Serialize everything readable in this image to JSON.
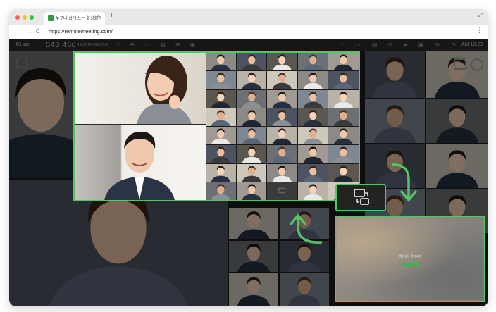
{
  "browser": {
    "tab_title": "누구나 쉽게 쓰는 화상회의",
    "tab_close": "×",
    "new_tab": "+",
    "resize_glyph": "⤢",
    "back": "←",
    "forward": "→",
    "reload": "C",
    "url": "https://remotemeeting.com/",
    "menu_glyph": "⋮",
    "traffic_colors": [
      "#ff5f57",
      "#febc2e",
      "#28c840"
    ]
  },
  "toolbar": {
    "room_no": "01",
    "room_sub": "#18",
    "meeting_id": "543 456",
    "tag": "REMOTE MEETING",
    "icons_left": "⚇ ⊕ ▭ ▤ ⊕ ◉",
    "icons_right": "◔ ▭ ▤ ◘ ● ▣ ⊚ ⊙",
    "time": "AM 10:23"
  },
  "share_screen": {
    "message": "화면공유 중입니다"
  },
  "icons": {
    "switch": "switch-layout-icon",
    "arrow_down": "arrow-down-icon",
    "arrow_up": "arrow-up-icon"
  },
  "colors": {
    "accent": "#55c467",
    "app_bg": "#1c1c1c",
    "dim_overlay": "rgba(0,0,0,0.48)"
  },
  "participant_grid": {
    "columns": 5,
    "rows": 8
  }
}
